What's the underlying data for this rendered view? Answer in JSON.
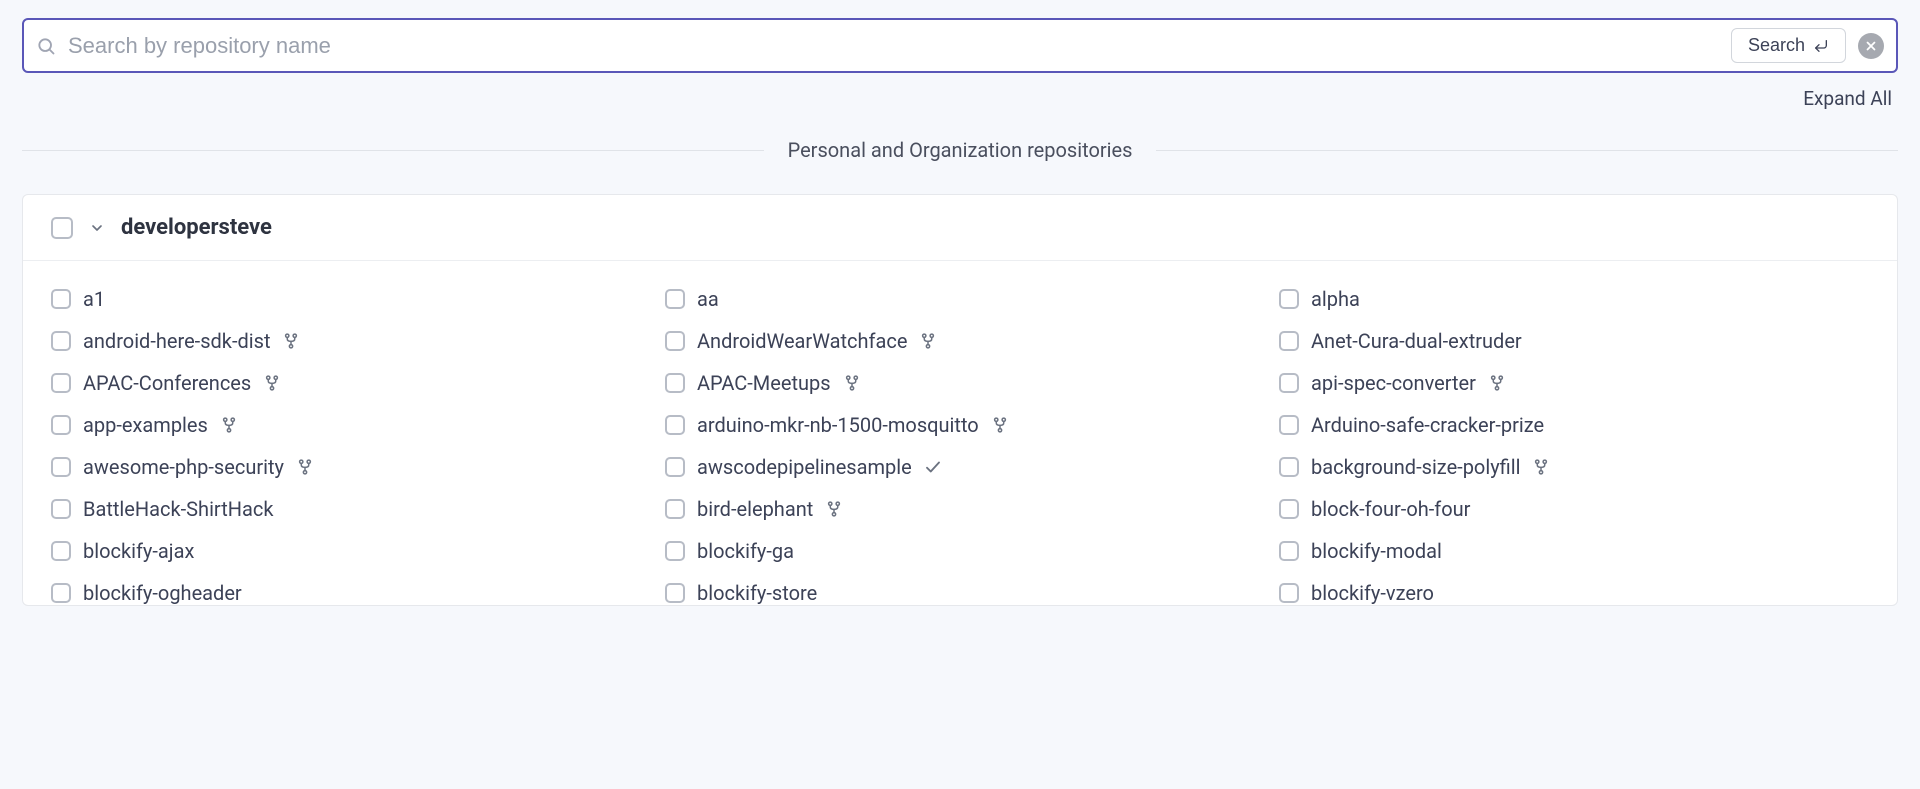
{
  "search": {
    "placeholder": "Search by repository name",
    "button_label": "Search"
  },
  "expand_all_label": "Expand All",
  "section_label": "Personal and Organization repositories",
  "owner": "developersteve",
  "repos": [
    {
      "name": "a1",
      "icon": ""
    },
    {
      "name": "aa",
      "icon": ""
    },
    {
      "name": "alpha",
      "icon": ""
    },
    {
      "name": "android-here-sdk-dist",
      "icon": "fork"
    },
    {
      "name": "AndroidWearWatchface",
      "icon": "fork"
    },
    {
      "name": "Anet-Cura-dual-extruder",
      "icon": ""
    },
    {
      "name": "APAC-Conferences",
      "icon": "fork"
    },
    {
      "name": "APAC-Meetups",
      "icon": "fork"
    },
    {
      "name": "api-spec-converter",
      "icon": "fork"
    },
    {
      "name": "app-examples",
      "icon": "fork"
    },
    {
      "name": "arduino-mkr-nb-1500-mosquitto",
      "icon": "fork"
    },
    {
      "name": "Arduino-safe-cracker-prize",
      "icon": ""
    },
    {
      "name": "awesome-php-security",
      "icon": "fork"
    },
    {
      "name": "awscodepipelinesample",
      "icon": "check"
    },
    {
      "name": "background-size-polyfill",
      "icon": "fork"
    },
    {
      "name": "BattleHack-ShirtHack",
      "icon": ""
    },
    {
      "name": "bird-elephant",
      "icon": "fork"
    },
    {
      "name": "block-four-oh-four",
      "icon": ""
    },
    {
      "name": "blockify-ajax",
      "icon": ""
    },
    {
      "name": "blockify-ga",
      "icon": ""
    },
    {
      "name": "blockify-modal",
      "icon": ""
    },
    {
      "name": "blockify-ogheader",
      "icon": ""
    },
    {
      "name": "blockify-store",
      "icon": ""
    },
    {
      "name": "blockify-vzero",
      "icon": ""
    }
  ]
}
